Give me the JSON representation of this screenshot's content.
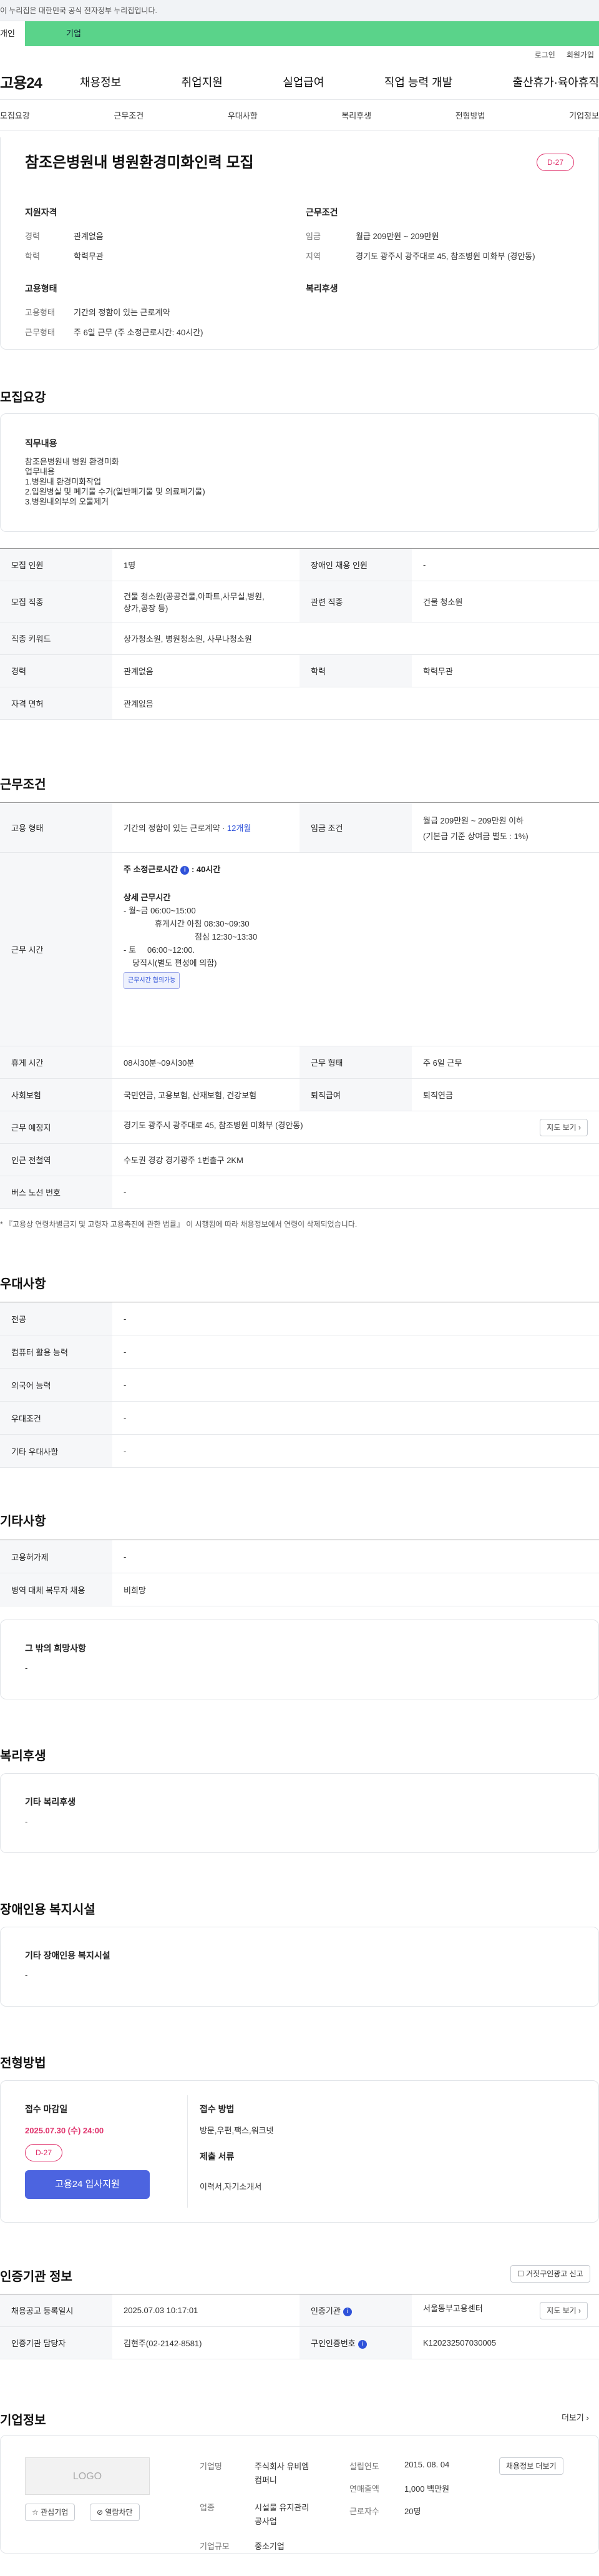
{
  "gov_banner": "이 누리집은 대한민국 공식 전자정부 누리집입니다.",
  "top_tabs": {
    "personal": "개인",
    "company": "기업"
  },
  "util": {
    "login": "로그인",
    "join": "회원가입"
  },
  "logo": "고용24",
  "gnb": [
    "채용정보",
    "취업지원",
    "실업급여",
    "직업 능력 개발",
    "출산휴가·육아휴직"
  ],
  "subnav": [
    "모집요강",
    "근무조건",
    "우대사항",
    "복리후생",
    "전형방법",
    "기업정보"
  ],
  "job": {
    "title": "참조은병원내 병원환경미화인력 모집",
    "dday": "D-27"
  },
  "summary": {
    "qual_h": "지원자격",
    "exp_l": "경력",
    "exp_v": "관계없음",
    "edu_l": "학력",
    "edu_v": "학력무관",
    "cond_h": "근무조건",
    "wage_l": "임금",
    "wage_v": "월급 209만원 ~ 209만원",
    "area_l": "지역",
    "area_v": "경기도 광주시 광주대로 45, 참조병원 미화부 (경안동)",
    "emp_h": "고용형태",
    "type_l": "고용형태",
    "type_v": "기간의 정함이 있는 근로계약",
    "form_l": "근무형태",
    "form_v": "주 6일 근무 (주 소정근로시간: 40시간)",
    "welfare_h": "복리후생"
  },
  "recruit": {
    "h": "모집요강",
    "duty_h": "직무내용",
    "duty_lines": [
      "참조은병원내 병원 환경미화",
      "업무내용",
      "1.병원내 환경미화작업",
      "2.입원병실 및 폐기물 수거(일반폐기물 및 의료폐기물)",
      "3.병원내외부의 오물제거"
    ],
    "rows": {
      "cnt_l": "모집 인원",
      "cnt_v": "1명",
      "dis_l": "장애인 채용 인원",
      "dis_v": "-",
      "job_l": "모집 직종",
      "job_v1": "건물 청소원(공공건물,아파트,사무실,병원,",
      "job_v2": "상가,공장 등)",
      "rel_l": "관련 직종",
      "rel_v": "건물 청소원",
      "kw_l": "직종 키워드",
      "kw_v": "상가청소원, 병원청소원, 사무나청소원",
      "exp_l": "경력",
      "exp_v": "관계없음",
      "edu_l": "학력",
      "edu_v": "학력무관",
      "lic_l": "자격 면허",
      "lic_v": "관계없음"
    }
  },
  "cond": {
    "h": "근무조건",
    "emp_l": "고용 형태",
    "emp_v": "기간의 정함이 있는 근로계약 · ",
    "emp_v2": "12개월",
    "wage_l": "임금 조건",
    "wage_v": "월급 209만원 ~ 209만원 이하",
    "wage_v2": "(기본급 기준 상여금 별도 : 1%)",
    "time_l": "근무 시간",
    "hours": "주 소정근로시간",
    "hours_v": ": 40시간",
    "detail_h": "상세 근무시간",
    "d1": "- 월~금 06:00~15:00",
    "d2": "휴게시간 아침 08:30~09:30",
    "d3": "점심 12:30~13:30",
    "d4": "- 토     06:00~12:00.",
    "d5": "당직시(별도 편성에 의함)",
    "chip": "근무시간 협의가능",
    "rest_l": "휴게 시간",
    "rest_v": "08시30분~09시30분",
    "form_l": "근무 형태",
    "form_v": "주 6일 근무",
    "ins_l": "사회보험",
    "ins_v": "국민연금, 고용보험, 산재보험, 건강보험",
    "ret_l": "퇴직급여",
    "ret_v": "퇴직연금",
    "place_l": "근무 예정지",
    "place_v": "경기도 광주시 광주대로 45, 참조병원 미화부 (경안동)",
    "map": "지도 보기",
    "sub_l": "인근 전철역",
    "sub_v": "수도권 경강 경기광주 1번출구 2KM",
    "bus_l": "버스 노선 번호",
    "bus_v": "-",
    "note": "* 『고용상 연령차별금지 및 고령자 고용촉진에 관한 법률』 이 시행됨에 따라 채용정보에서 연령이 삭제되었습니다."
  },
  "pref": {
    "h": "우대사항",
    "rows": [
      [
        "전공",
        "-"
      ],
      [
        "컴퓨터 활용 능력",
        "-"
      ],
      [
        "외국어 능력",
        "-"
      ],
      [
        "우대조건",
        "-"
      ],
      [
        "기타 우대사항",
        "-"
      ]
    ]
  },
  "etc": {
    "h": "기타사항",
    "rows": [
      [
        "고용허가제",
        "-"
      ],
      [
        "병역 대체 복무자 채용",
        "비희망"
      ]
    ],
    "other_h": "그 밖의 희망사항",
    "other_v": "-"
  },
  "welfare": {
    "h": "복리후생",
    "box_h": "기타 복리후생",
    "box_v": "-"
  },
  "disabled": {
    "h": "장애인용 복지시설",
    "box_h": "기타 장애인용 복지시설",
    "box_v": "-"
  },
  "process": {
    "h": "전형방법",
    "deadline_h": "접수 마감일",
    "deadline_v": "2025.07.30 (수) 24:00",
    "dday": "D-27",
    "apply": "고용24 입사지원",
    "method_h": "접수 방법",
    "method_v": "방문,우편,팩스,워크넷",
    "docs_h": "제출 서류",
    "docs_v": "이력서,자기소개서"
  },
  "auth": {
    "h": "인증기관 정보",
    "report": "거짓구인광고 신고",
    "reg_l": "채용공고 등록일시",
    "reg_v": "2025.07.03 10:17:01",
    "org_l": "인증기관",
    "org_v": "서울동부고용센터",
    "map": "지도 보기",
    "mgr_l": "인증기관 담당자",
    "mgr_v": "김현주(02-2142-8581)",
    "no_l": "구인인증번호",
    "no_v": "K120232507030005"
  },
  "company": {
    "h": "기업정보",
    "more": "더보기",
    "logo": "LOGO",
    "fav": "관심기업",
    "block": "열람차단",
    "name_l": "기업명",
    "name_v1": "주식회사 유비엠",
    "name_v2": "컴퍼니",
    "ind_l": "업종",
    "ind_v1": "시설물 유지관리",
    "ind_v2": "공사업",
    "size_l": "기업규모",
    "size_v": "중소기업",
    "year_l": "설립연도",
    "year_v": "2015. 08. 04",
    "sales_l": "연매출액",
    "sales_v": "1,000 백만원",
    "emp_l": "근로자수",
    "emp_v": "20명",
    "detail": "채용정보 더보기"
  }
}
